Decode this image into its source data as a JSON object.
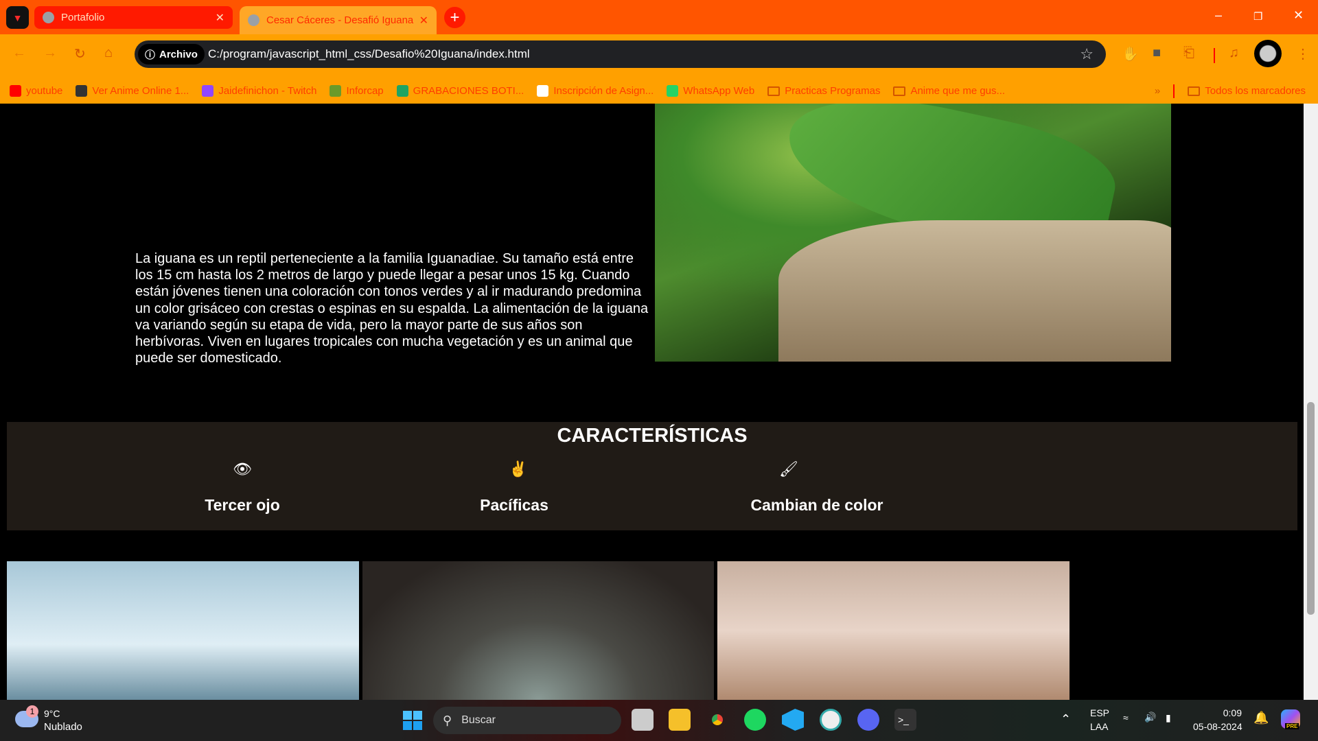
{
  "browser": {
    "tabs": [
      {
        "title": "Portafolio",
        "active": false
      },
      {
        "title": "Cesar Cáceres - Desafió Iguana",
        "active": true
      }
    ],
    "address": {
      "chip": "Archivo",
      "url": "C:/program/javascript_html_css/Desafio%20Iguana/index.html"
    },
    "bookmarks": [
      {
        "label": "youtube",
        "icon": "youtube-icon",
        "color": "#ff0000"
      },
      {
        "label": "Ver Anime Online 1...",
        "icon": "animeflv-icon",
        "color": "#333333"
      },
      {
        "label": "Jaidefinichon - Twitch",
        "icon": "twitch-icon",
        "color": "#9146ff"
      },
      {
        "label": "Inforcap",
        "icon": "inforcap-icon",
        "color": "#6a9a2a"
      },
      {
        "label": "GRABACIONES BOTI...",
        "icon": "sheets-icon",
        "color": "#1fa463"
      },
      {
        "label": "Inscripción de Asign...",
        "icon": "page-icon",
        "color": "#ffffff"
      },
      {
        "label": "WhatsApp Web",
        "icon": "whatsapp-icon",
        "color": "#25d366"
      },
      {
        "label": "Practicas Programas",
        "icon": "folder-icon"
      },
      {
        "label": "Anime que me gus...",
        "icon": "folder-icon"
      }
    ],
    "bookmarks_overflow": "»",
    "all_bookmarks": "Todos los marcadores",
    "colors": {
      "tabbar": "#ff5500",
      "toolbar": "#ffa000"
    }
  },
  "page": {
    "description": "La iguana es un reptil perteneciente a la familia Iguanadiae. Su tamaño está entre los 15 cm hasta los 2 metros de largo y puede llegar a pesar unos 15 kg. Cuando están jóvenes tienen una coloración con tonos verdes y al ir madurando predomina un color grisáceo con crestas o espinas en su espalda. La alimentación de la iguana va variando según su etapa de vida, pero la mayor parte de sus años son herbívoras. Viven en lugares tropicales con mucha vegetación y es un animal que puede ser domesticado.",
    "features_title": "CARACTERÍSTICAS",
    "features": [
      {
        "label": "Tercer ojo",
        "icon": "eye-icon"
      },
      {
        "label": "Pacíficas",
        "icon": "peace-hand-icon"
      },
      {
        "label": "Cambian de color",
        "icon": "paintbrush-icon"
      }
    ]
  },
  "taskbar": {
    "weather": {
      "temp": "9°C",
      "condition": "Nublado",
      "badge": "1"
    },
    "search_placeholder": "Buscar",
    "lang": {
      "top": "ESP",
      "bottom": "LAA"
    },
    "time": "0:09",
    "date": "05-08-2024",
    "copilot_badge": "PRE"
  }
}
